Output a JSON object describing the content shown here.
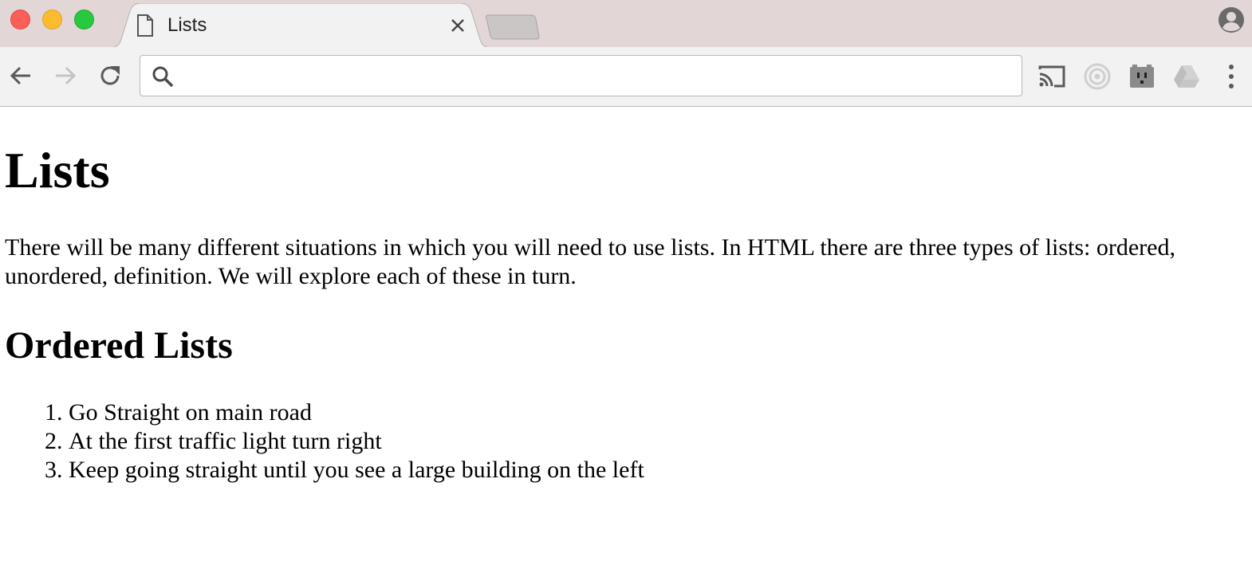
{
  "browser": {
    "tab": {
      "title": "Lists"
    },
    "address_bar": {
      "value": "",
      "placeholder": ""
    }
  },
  "page": {
    "heading": "Lists",
    "intro": "There will be many different situations in which you will need to use lists. In HTML there are three types of lists: ordered, unordered, definition. We will explore each of these in turn.",
    "section_heading": "Ordered Lists",
    "ordered_items": [
      "Go Straight on main road",
      "At the first traffic light turn right",
      "Keep going straight until you see a large building on the left"
    ]
  },
  "colors": {
    "tabstrip": "#e2d6d6",
    "toolbar": "#f2f2f2",
    "close": "#fc5f57",
    "minimize": "#fdbc2e",
    "maximize": "#28c840"
  }
}
